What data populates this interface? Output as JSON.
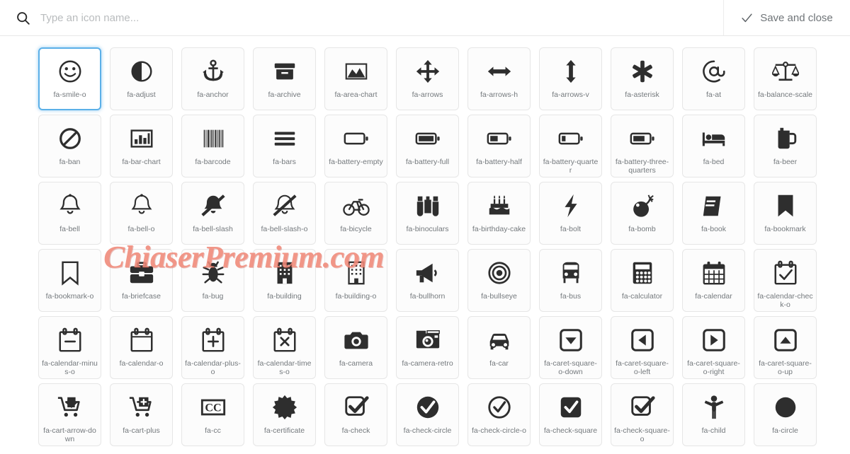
{
  "header": {
    "search_placeholder": "Type an icon name...",
    "search_value": "",
    "search_icon": "search-icon",
    "save_label": "Save and close",
    "save_icon": "check-icon"
  },
  "watermark": {
    "text": "ChiaserPremium.com",
    "color": "#f08878"
  },
  "colors": {
    "selected_border": "#5bb0e8",
    "tile_border": "#e6e6e6",
    "label_text": "#74797d",
    "glyph": "#2e2e2e"
  },
  "grid": {
    "columns": 11,
    "selected_index": 0,
    "icons": [
      {
        "label": "fa-smile-o",
        "icon": "smile-o-icon",
        "selected": true
      },
      {
        "label": "fa-adjust",
        "icon": "adjust-icon"
      },
      {
        "label": "fa-anchor",
        "icon": "anchor-icon"
      },
      {
        "label": "fa-archive",
        "icon": "archive-icon"
      },
      {
        "label": "fa-area-chart",
        "icon": "area-chart-icon"
      },
      {
        "label": "fa-arrows",
        "icon": "arrows-icon"
      },
      {
        "label": "fa-arrows-h",
        "icon": "arrows-h-icon"
      },
      {
        "label": "fa-arrows-v",
        "icon": "arrows-v-icon"
      },
      {
        "label": "fa-asterisk",
        "icon": "asterisk-icon"
      },
      {
        "label": "fa-at",
        "icon": "at-icon"
      },
      {
        "label": "fa-balance-scale",
        "icon": "balance-scale-icon"
      },
      {
        "label": "fa-ban",
        "icon": "ban-icon"
      },
      {
        "label": "fa-bar-chart",
        "icon": "bar-chart-icon"
      },
      {
        "label": "fa-barcode",
        "icon": "barcode-icon"
      },
      {
        "label": "fa-bars",
        "icon": "bars-icon"
      },
      {
        "label": "fa-battery-empty",
        "icon": "battery-empty-icon"
      },
      {
        "label": "fa-battery-full",
        "icon": "battery-full-icon"
      },
      {
        "label": "fa-battery-half",
        "icon": "battery-half-icon"
      },
      {
        "label": "fa-battery-quarter",
        "icon": "battery-quarter-icon"
      },
      {
        "label": "fa-battery-three-quarters",
        "icon": "battery-three-quarters-icon"
      },
      {
        "label": "fa-bed",
        "icon": "bed-icon"
      },
      {
        "label": "fa-beer",
        "icon": "beer-icon"
      },
      {
        "label": "fa-bell",
        "icon": "bell-icon"
      },
      {
        "label": "fa-bell-o",
        "icon": "bell-o-icon"
      },
      {
        "label": "fa-bell-slash",
        "icon": "bell-slash-icon"
      },
      {
        "label": "fa-bell-slash-o",
        "icon": "bell-slash-o-icon"
      },
      {
        "label": "fa-bicycle",
        "icon": "bicycle-icon"
      },
      {
        "label": "fa-binoculars",
        "icon": "binoculars-icon"
      },
      {
        "label": "fa-birthday-cake",
        "icon": "birthday-cake-icon"
      },
      {
        "label": "fa-bolt",
        "icon": "bolt-icon"
      },
      {
        "label": "fa-bomb",
        "icon": "bomb-icon"
      },
      {
        "label": "fa-book",
        "icon": "book-icon"
      },
      {
        "label": "fa-bookmark",
        "icon": "bookmark-icon"
      },
      {
        "label": "fa-bookmark-o",
        "icon": "bookmark-o-icon"
      },
      {
        "label": "fa-briefcase",
        "icon": "briefcase-icon"
      },
      {
        "label": "fa-bug",
        "icon": "bug-icon"
      },
      {
        "label": "fa-building",
        "icon": "building-icon"
      },
      {
        "label": "fa-building-o",
        "icon": "building-o-icon"
      },
      {
        "label": "fa-bullhorn",
        "icon": "bullhorn-icon"
      },
      {
        "label": "fa-bullseye",
        "icon": "bullseye-icon"
      },
      {
        "label": "fa-bus",
        "icon": "bus-icon"
      },
      {
        "label": "fa-calculator",
        "icon": "calculator-icon"
      },
      {
        "label": "fa-calendar",
        "icon": "calendar-icon"
      },
      {
        "label": "fa-calendar-check-o",
        "icon": "calendar-check-o-icon"
      },
      {
        "label": "fa-calendar-minus-o",
        "icon": "calendar-minus-o-icon"
      },
      {
        "label": "fa-calendar-o",
        "icon": "calendar-o-icon"
      },
      {
        "label": "fa-calendar-plus-o",
        "icon": "calendar-plus-o-icon"
      },
      {
        "label": "fa-calendar-times-o",
        "icon": "calendar-times-o-icon"
      },
      {
        "label": "fa-camera",
        "icon": "camera-icon"
      },
      {
        "label": "fa-camera-retro",
        "icon": "camera-retro-icon"
      },
      {
        "label": "fa-car",
        "icon": "car-icon"
      },
      {
        "label": "fa-caret-square-o-down",
        "icon": "caret-square-o-down-icon"
      },
      {
        "label": "fa-caret-square-o-left",
        "icon": "caret-square-o-left-icon"
      },
      {
        "label": "fa-caret-square-o-right",
        "icon": "caret-square-o-right-icon"
      },
      {
        "label": "fa-caret-square-o-up",
        "icon": "caret-square-o-up-icon"
      },
      {
        "label": "fa-cart-arrow-down",
        "icon": "cart-arrow-down-icon"
      },
      {
        "label": "fa-cart-plus",
        "icon": "cart-plus-icon"
      },
      {
        "label": "fa-cc",
        "icon": "cc-icon"
      },
      {
        "label": "fa-certificate",
        "icon": "certificate-icon"
      },
      {
        "label": "fa-check",
        "icon": "check-icon"
      },
      {
        "label": "fa-check-circle",
        "icon": "check-circle-icon"
      },
      {
        "label": "fa-check-circle-o",
        "icon": "check-circle-o-icon"
      },
      {
        "label": "fa-check-square",
        "icon": "check-square-icon"
      },
      {
        "label": "fa-check-square-o",
        "icon": "check-square-o-icon"
      },
      {
        "label": "fa-child",
        "icon": "child-icon"
      },
      {
        "label": "fa-circle",
        "icon": "circle-icon"
      }
    ]
  }
}
